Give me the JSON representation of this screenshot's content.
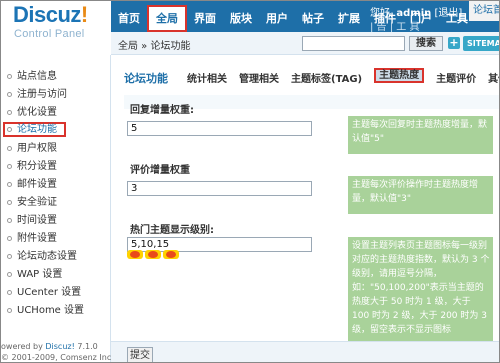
{
  "brand": {
    "logo_main": "Discuz",
    "logo_bang": "!",
    "logo_sub": "Control Panel"
  },
  "nav": {
    "tabs": [
      {
        "label": "首页",
        "active": false
      },
      {
        "label": "全局",
        "active": true
      },
      {
        "label": "界面",
        "active": false
      },
      {
        "label": "版块",
        "active": false
      },
      {
        "label": "用户",
        "active": false
      },
      {
        "label": "帖子",
        "active": false
      },
      {
        "label": "扩展",
        "active": false
      },
      {
        "label": "插件",
        "active": false
      },
      {
        "label": "门户",
        "active": false
      },
      {
        "label": "工具",
        "active": false
      }
    ]
  },
  "user_bar": {
    "greeting": "您好,",
    "username": "admin",
    "logout": "[退出]",
    "forum_home": "论坛首"
  },
  "tools_row": "| 告 | 工 具",
  "breadcrumb": {
    "text": "全局 » 论坛功能"
  },
  "search": {
    "value": "",
    "placeholder": "",
    "button_label": "搜索",
    "plus_label": "+",
    "sitemap_label": "SITEMAP"
  },
  "sidebar": {
    "items": [
      {
        "label": "站点信息",
        "active": false
      },
      {
        "label": "注册与访问",
        "active": false
      },
      {
        "label": "优化设置",
        "active": false
      },
      {
        "label": "论坛功能",
        "active": true
      },
      {
        "label": "用户权限",
        "active": false
      },
      {
        "label": "积分设置",
        "active": false
      },
      {
        "label": "邮件设置",
        "active": false
      },
      {
        "label": "安全验证",
        "active": false
      },
      {
        "label": "时间设置",
        "active": false
      },
      {
        "label": "附件设置",
        "active": false
      },
      {
        "label": "论坛动态设置",
        "active": false
      },
      {
        "label": "WAP 设置",
        "active": false
      },
      {
        "label": "UCenter 设置",
        "active": false
      },
      {
        "label": "UCHome 设置",
        "active": false
      }
    ],
    "footer_line1_prefix": "owered by ",
    "footer_brand": "Discuz!",
    "footer_version": " 7.1.0",
    "footer_line2": "© 2001-2009, Comsenz Inc."
  },
  "main": {
    "title": "论坛功能",
    "subtabs": [
      {
        "label": "统计相关",
        "active": false
      },
      {
        "label": "管理相关",
        "active": false
      },
      {
        "label": "主题标签(TAG)",
        "active": false
      },
      {
        "label": "主题热度",
        "active": true
      },
      {
        "label": "主题评价",
        "active": false
      },
      {
        "label": "其他",
        "active": false
      }
    ],
    "fields": [
      {
        "label": "回复增量权重:",
        "value": "5",
        "hint": "主题每次回复时主题热度增量，默认值\"5\""
      },
      {
        "label": "评价增量权重",
        "value": "3",
        "hint": "主题每次评价操作时主题热度增量，默认值\"3\""
      },
      {
        "label": "热门主题显示级别:",
        "value": "5,10,15",
        "hint": "设置主题列表页主题图标每一级别对应的主题热度指数，默认为 3 个级别，请用逗号分隔，如：\"50,100,200\"表示当主题的热度大于 50 时为 1 级，大于 100 时为 2 级，大于 200 时为 3 级，留空表示不显示图标"
      }
    ],
    "fire_icons": [
      "hot-level-1-icon",
      "hot-level-2-icon",
      "hot-level-3-icon"
    ],
    "submit_label": "提交"
  },
  "colors": {
    "header_blue": "#1e6fa8",
    "accent_red": "#d9332c",
    "hint_green": "#a9d29a",
    "crumb_bg": "#eef4f9"
  }
}
